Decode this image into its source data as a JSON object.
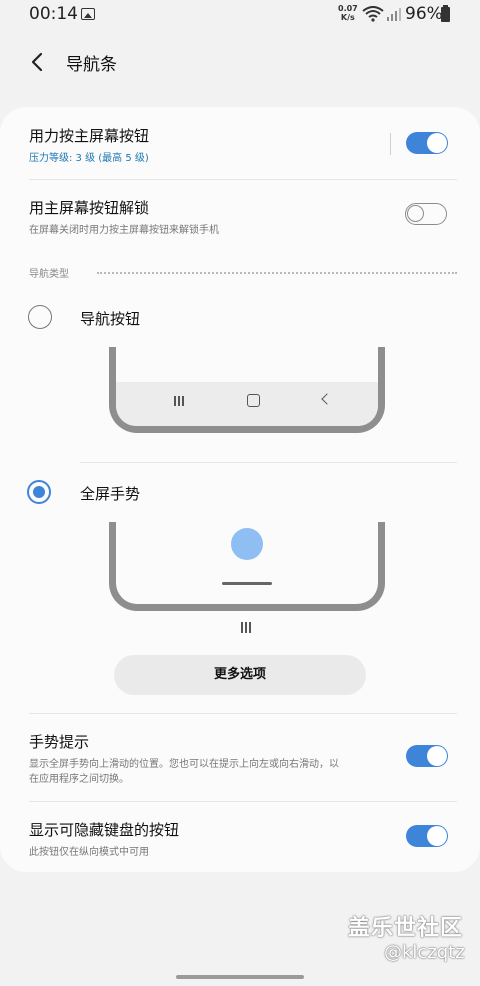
{
  "status": {
    "time": "00:14",
    "net_speed_value": "0.07",
    "net_speed_unit": "K/s",
    "battery": "96%"
  },
  "header": {
    "title": "导航条"
  },
  "settings": {
    "press_home": {
      "title": "用力按主屏幕按钮",
      "subtitle": "压力等级: 3 级 (最高 5 级)",
      "enabled": true
    },
    "unlock_home": {
      "title": "用主屏幕按钮解锁",
      "subtitle": "在屏幕关闭时用力按主屏幕按钮来解锁手机",
      "enabled": false
    }
  },
  "nav_type": {
    "section_label": "导航类型",
    "options": [
      {
        "label": "导航按钮",
        "selected": false
      },
      {
        "label": "全屏手势",
        "selected": true
      }
    ]
  },
  "more_button": "更多选项",
  "gesture_hint": {
    "title": "手势提示",
    "subtitle_line1": "显示全屏手势向上滑动的位置。您也可以在提示上向左或向右滑动，以",
    "subtitle_line2": "在应用程序之间切换。",
    "enabled": true
  },
  "keyboard_button": {
    "title": "显示可隐藏键盘的按钮",
    "subtitle": "此按钮仅在纵向模式中可用",
    "enabled": true
  },
  "watermark": {
    "title": "盖乐世社区",
    "handle": "@klczqtz"
  },
  "colors": {
    "accent": "#3e84d9",
    "background": "#f2f2f2",
    "card": "#fbfbfb"
  }
}
